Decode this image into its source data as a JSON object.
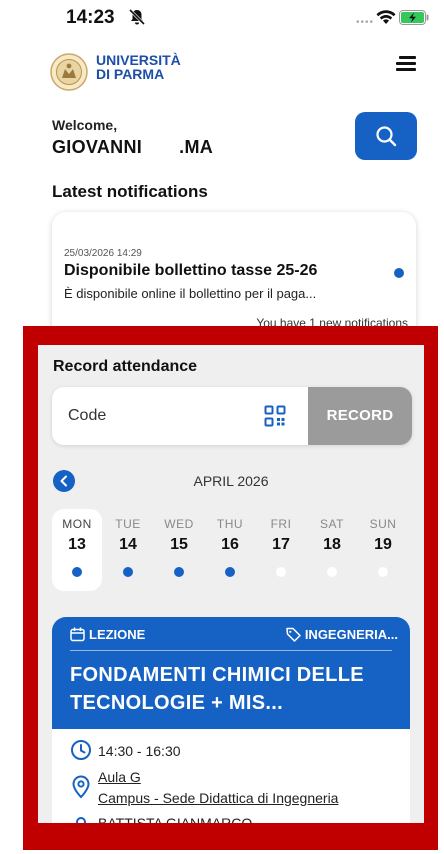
{
  "status_bar": {
    "time": "14:23"
  },
  "header": {
    "university_line1": "UNIVERSITÀ",
    "university_line2": "DI PARMA"
  },
  "welcome": {
    "label": "Welcome,",
    "user_name": "GIOVANNI       .MA"
  },
  "notifications": {
    "section_title": "Latest notifications",
    "items": [
      {
        "date": "25/03/2026 14:29",
        "title": "Disponibile bollettino tasse 25-26",
        "body": "È disponibile online il bollettino per il paga...",
        "unread": true
      }
    ],
    "count_text": "You have 1 new notifications"
  },
  "attendance": {
    "title": "Record attendance",
    "code_placeholder": "Code",
    "record_label": "RECORD",
    "month": "APRIL 2026",
    "days": [
      {
        "dow": "MON",
        "num": "13",
        "has_event": true,
        "selected": true
      },
      {
        "dow": "TUE",
        "num": "14",
        "has_event": true,
        "selected": false
      },
      {
        "dow": "WED",
        "num": "15",
        "has_event": true,
        "selected": false
      },
      {
        "dow": "THU",
        "num": "16",
        "has_event": true,
        "selected": false
      },
      {
        "dow": "FRI",
        "num": "17",
        "has_event": false,
        "selected": false
      },
      {
        "dow": "SAT",
        "num": "18",
        "has_event": false,
        "selected": false
      },
      {
        "dow": "SUN",
        "num": "19",
        "has_event": false,
        "selected": false
      }
    ],
    "lesson": {
      "type": "LEZIONE",
      "department": "INGEGNERIA...",
      "title": "FONDAMENTI CHIMICI DELLE TECNOLOGIE + MIS...",
      "time": "14:30 - 16:30",
      "room": "Aula G",
      "campus": "Campus - Sede Didattica di Ingegneria",
      "teacher": "BATTISTA GIANMARCO"
    }
  },
  "colors": {
    "accent": "#1661c4",
    "frame": "#c00000",
    "record_disabled": "#9b9b9b"
  }
}
